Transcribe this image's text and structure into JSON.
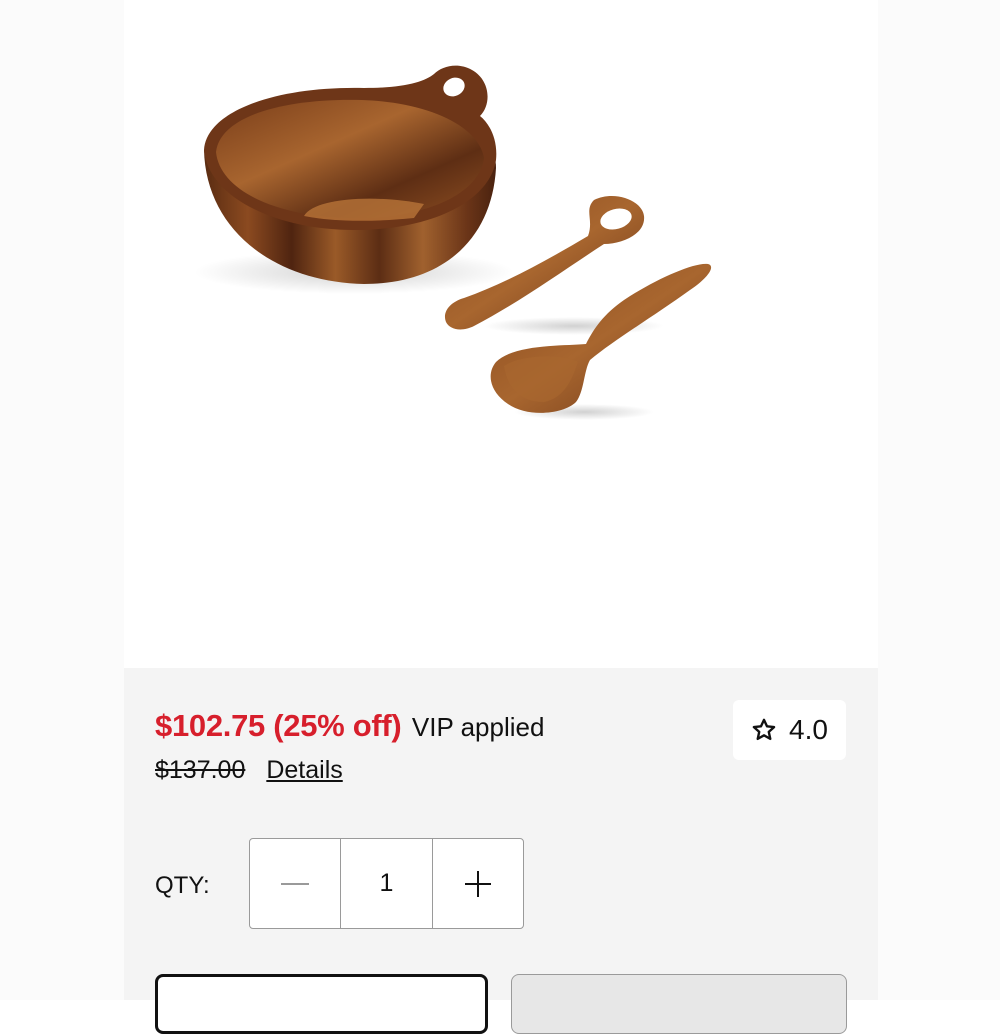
{
  "product": {
    "image_alt": "Wooden salad bowl with serving utensils"
  },
  "pricing": {
    "sale_price": "$102.75 (25% off)",
    "vip_note": "VIP applied",
    "original_price": "$137.00",
    "details_label": "Details",
    "accent_color": "#d71f2c"
  },
  "rating": {
    "icon": "star-outline-icon",
    "value": "4.0"
  },
  "quantity": {
    "label": "QTY:",
    "value": "1",
    "decrement_icon": "minus-icon",
    "increment_icon": "plus-icon"
  }
}
